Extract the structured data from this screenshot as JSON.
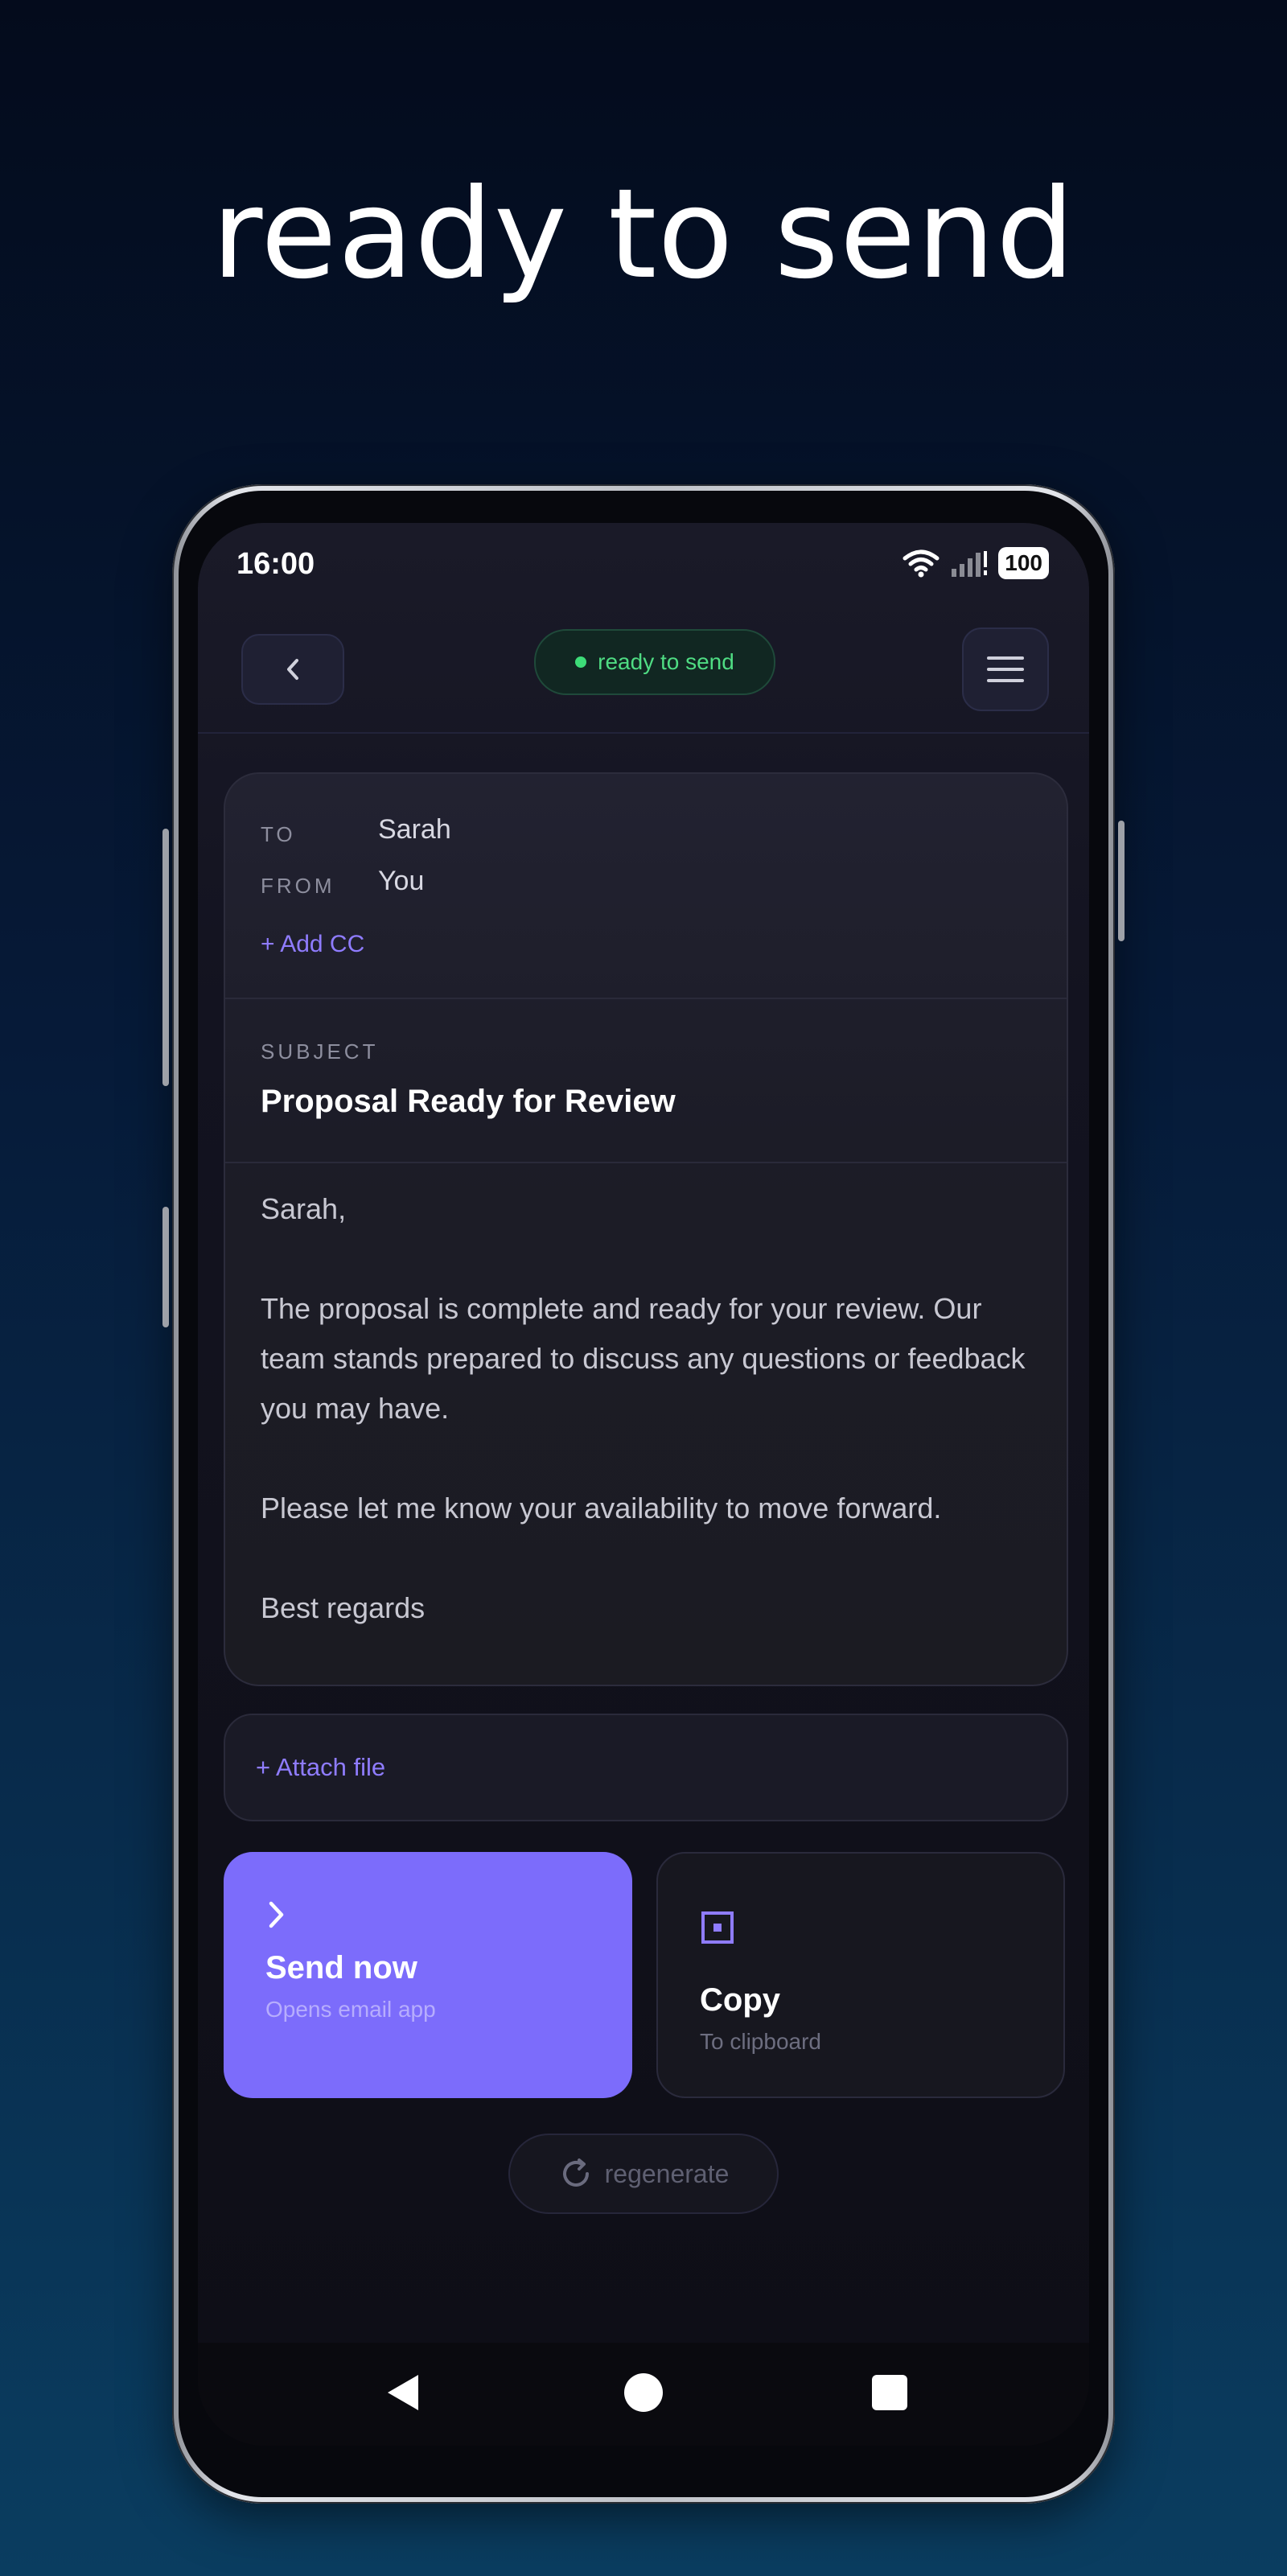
{
  "hero": {
    "title": "ready to send"
  },
  "status_bar": {
    "time": "16:00",
    "battery": "100"
  },
  "header": {
    "status_label": "ready to send",
    "status_color": "#3ddc78"
  },
  "email": {
    "to_label": "TO",
    "to_value": "Sarah",
    "from_label": "FROM",
    "from_value": "You",
    "add_cc": "+ Add CC",
    "subject_label": "SUBJECT",
    "subject_value": "Proposal Ready for Review",
    "body": {
      "greeting": "Sarah,",
      "paragraph_1": "The proposal is complete and ready for your review. Our team stands prepared to discuss any questions or feedback you may have.",
      "paragraph_2": "Please let me know your availability to move forward.",
      "signoff": "Best regards"
    }
  },
  "attach": {
    "label": "+ Attach file"
  },
  "actions": {
    "send": {
      "title": "Send now",
      "subtitle": "Opens email app",
      "color": "#7c6cfb"
    },
    "copy": {
      "title": "Copy",
      "subtitle": "To clipboard"
    },
    "regenerate": {
      "label": "regenerate"
    }
  },
  "colors": {
    "accent": "#8f7cff"
  }
}
